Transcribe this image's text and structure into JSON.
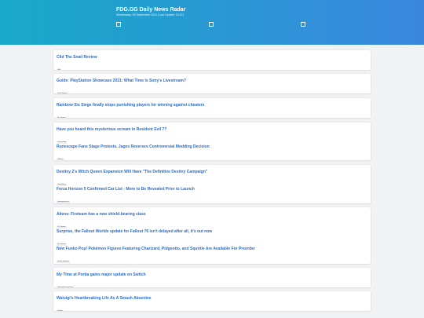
{
  "header": {
    "title": "FDG.GG Daily News Radar",
    "subtitle": "Wednesday, 08 September 2021 (Last Update: 15:47)"
  },
  "groups": [
    [
      {
        "headline": "Clid The Snail Review",
        "source": "IGN"
      }
    ],
    [
      {
        "headline": "Guide: PlayStation Showcase 2021: What Time Is Sony's Livestream?",
        "source": "Push Square"
      }
    ],
    [
      {
        "headline": "Rainbow Six Siege finally stops punishing players for winning against cheaters",
        "source": "PC Gamer"
      }
    ],
    [
      {
        "headline": "Have you heard this mysterious scream in Resident Evil 7?",
        "source": "Destructoid"
      },
      {
        "headline": "Runescape Fans Stage Protests, Jagex Reverses Controversial Modding Decision",
        "source": "GNews"
      }
    ],
    [
      {
        "headline": "Destiny 2's Witch Queen Expansion Will Have \"The Definitive Destiny Campaign\"",
        "source": "GameSpot"
      },
      {
        "headline": "Forza Horizon 5 Confirmed Car List - More to Be Revealed Prior to Launch",
        "source": "Gamepressure"
      }
    ],
    [
      {
        "headline": "Aliens: Fireteam has a new shield-bearing class",
        "source": "PC Gamer"
      },
      {
        "headline": "Surprise, the Fallout Worlds update for Fallout 76 isn't delayed after all, it's out now",
        "source": "PC Gamer"
      },
      {
        "headline": "New Funko Pop! Pokémon Figures Featuring Charizard, Pidgeotto, and Squirtle Are Available For Preorder",
        "source": "Game Informer"
      }
    ],
    [
      {
        "headline": "My Time at Portia gains major update on Switch",
        "source": "Nintendo Everything"
      }
    ],
    [
      {
        "headline": "Waluigi's Heartbreaking Life As A Smash Absentee",
        "source": "Kotaku"
      }
    ]
  ]
}
